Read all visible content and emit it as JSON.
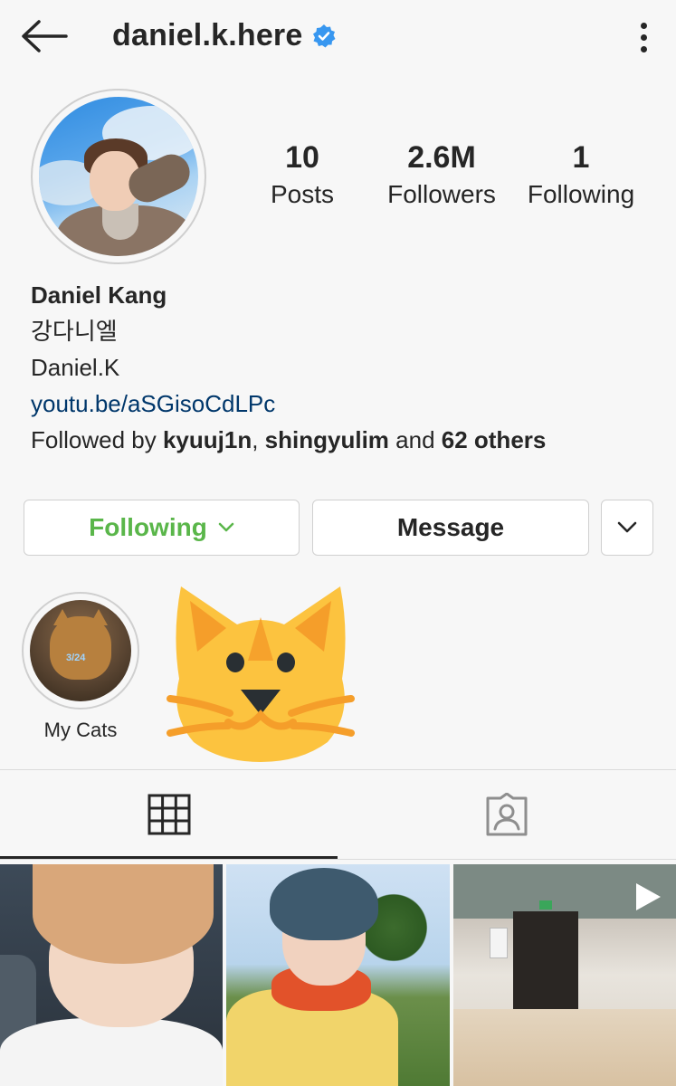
{
  "header": {
    "username": "daniel.k.here",
    "verified": true
  },
  "stats": {
    "posts_value": "10",
    "posts_label": "Posts",
    "followers_value": "2.6M",
    "followers_label": "Followers",
    "following_value": "1",
    "following_label": "Following"
  },
  "bio": {
    "name": "Daniel Kang",
    "line1": "강다니엘",
    "line2": "Daniel.K",
    "link": "youtu.be/aSGisoCdLPc",
    "followed_prefix": "Followed by ",
    "followed_user1": "kyuuj1n",
    "followed_sep": ", ",
    "followed_user2": "shingyulim",
    "followed_and": " and ",
    "followed_others": "62 others"
  },
  "actions": {
    "following_label": "Following",
    "message_label": "Message"
  },
  "highlights": [
    {
      "label": "My Cats",
      "image_text": "3/24"
    }
  ],
  "tabs": [
    {
      "icon": "grid-icon",
      "active": true
    },
    {
      "icon": "tagged-person-icon",
      "active": false
    }
  ],
  "colors": {
    "following_green": "#5ab64a",
    "link_blue": "#00376b",
    "verified_blue": "#3897f0",
    "background": "#f7f7f7"
  }
}
